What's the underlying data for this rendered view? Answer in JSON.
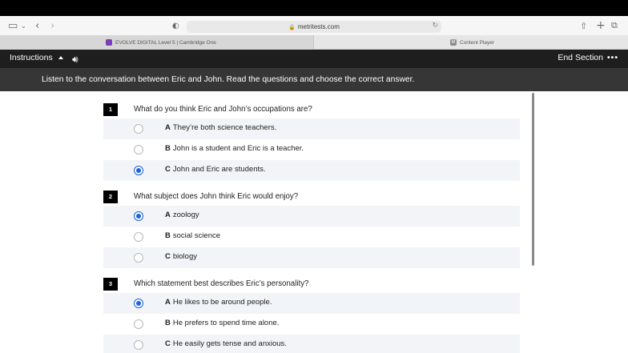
{
  "browser": {
    "url": "metritests.com",
    "tabs": [
      {
        "label": "EVOLVE DIGITAL Level 5 | Cambridge One",
        "favicon_color": "#7b3fb5"
      },
      {
        "label": "Content Player",
        "favicon_color": "#8a8a8a",
        "favicon_letter": "M"
      }
    ]
  },
  "app": {
    "instructions_label": "Instructions",
    "end_section_label": "End Section",
    "more_label": "•••",
    "instruction_text": "Listen to the conversation between Eric and John. Read the questions and choose the correct answer."
  },
  "questions": [
    {
      "number": "1",
      "text": "What do you think Eric and John’s occupations are?",
      "options": [
        {
          "letter": "A",
          "text": "They’re both science teachers.",
          "selected": false
        },
        {
          "letter": "B",
          "text": "John is a student and Eric is a teacher.",
          "selected": false
        },
        {
          "letter": "C",
          "text": "John and Eric are students.",
          "selected": true
        }
      ]
    },
    {
      "number": "2",
      "text": "What subject does John think Eric would enjoy?",
      "options": [
        {
          "letter": "A",
          "text": "zoology",
          "selected": true
        },
        {
          "letter": "B",
          "text": "social science",
          "selected": false
        },
        {
          "letter": "C",
          "text": "biology",
          "selected": false
        }
      ]
    },
    {
      "number": "3",
      "text": "Which statement best describes Eric’s personality?",
      "options": [
        {
          "letter": "A",
          "text": "He likes to be around people.",
          "selected": true
        },
        {
          "letter": "B",
          "text": "He prefers to spend time alone.",
          "selected": false
        },
        {
          "letter": "C",
          "text": "He easily gets tense and anxious.",
          "selected": false
        }
      ]
    }
  ],
  "colors": {
    "accent": "#1a62e0",
    "app_bar": "#1e1e1e",
    "instruction_bar": "#363636",
    "option_shade": "#f2f4f7"
  }
}
